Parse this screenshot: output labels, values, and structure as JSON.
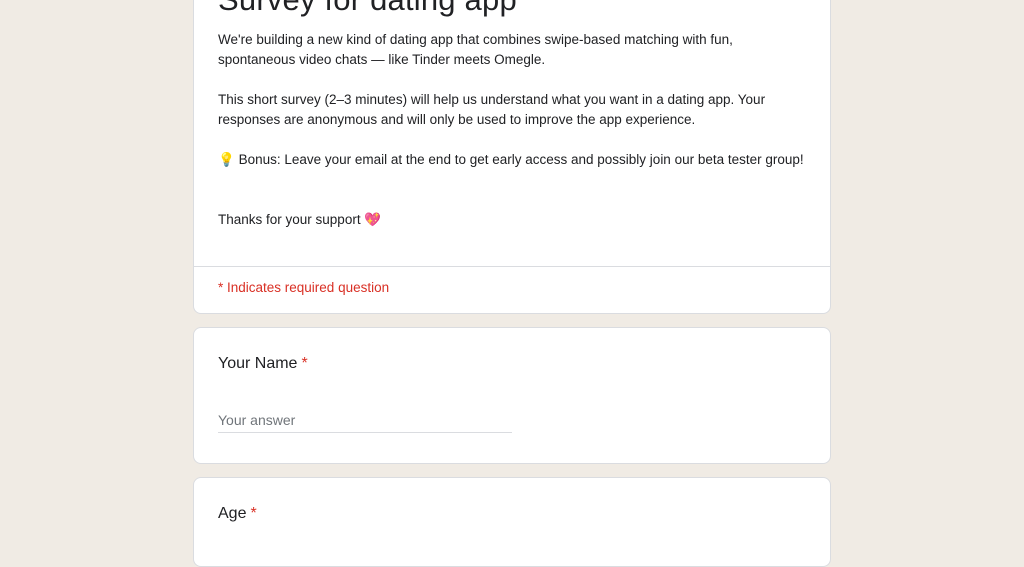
{
  "form": {
    "title": "Survey for dating app",
    "description": {
      "p1": "We're building a new kind of dating app that combines swipe-based matching with fun, spontaneous video chats — like Tinder meets Omegle.",
      "p2": "This short survey (2–3 minutes) will help us understand what you want in a dating app. Your responses are anonymous and will only be used to improve the app experience.",
      "p3_icon": "💡",
      "p3_text": " Bonus: Leave your email at the end to get early access and possibly join our beta tester group!",
      "p4_text": "Thanks for your support ",
      "p4_icon": "💖"
    },
    "required_note": "* Indicates required question"
  },
  "questions": [
    {
      "title": "Your Name",
      "required_mark": "*",
      "placeholder": "Your answer"
    },
    {
      "title": "Age",
      "required_mark": "*"
    }
  ],
  "colors": {
    "background": "#f0ebe4",
    "required": "#d93025",
    "text": "#202124"
  },
  "icons": [
    "light-bulb-icon",
    "sparkling-heart-icon"
  ]
}
